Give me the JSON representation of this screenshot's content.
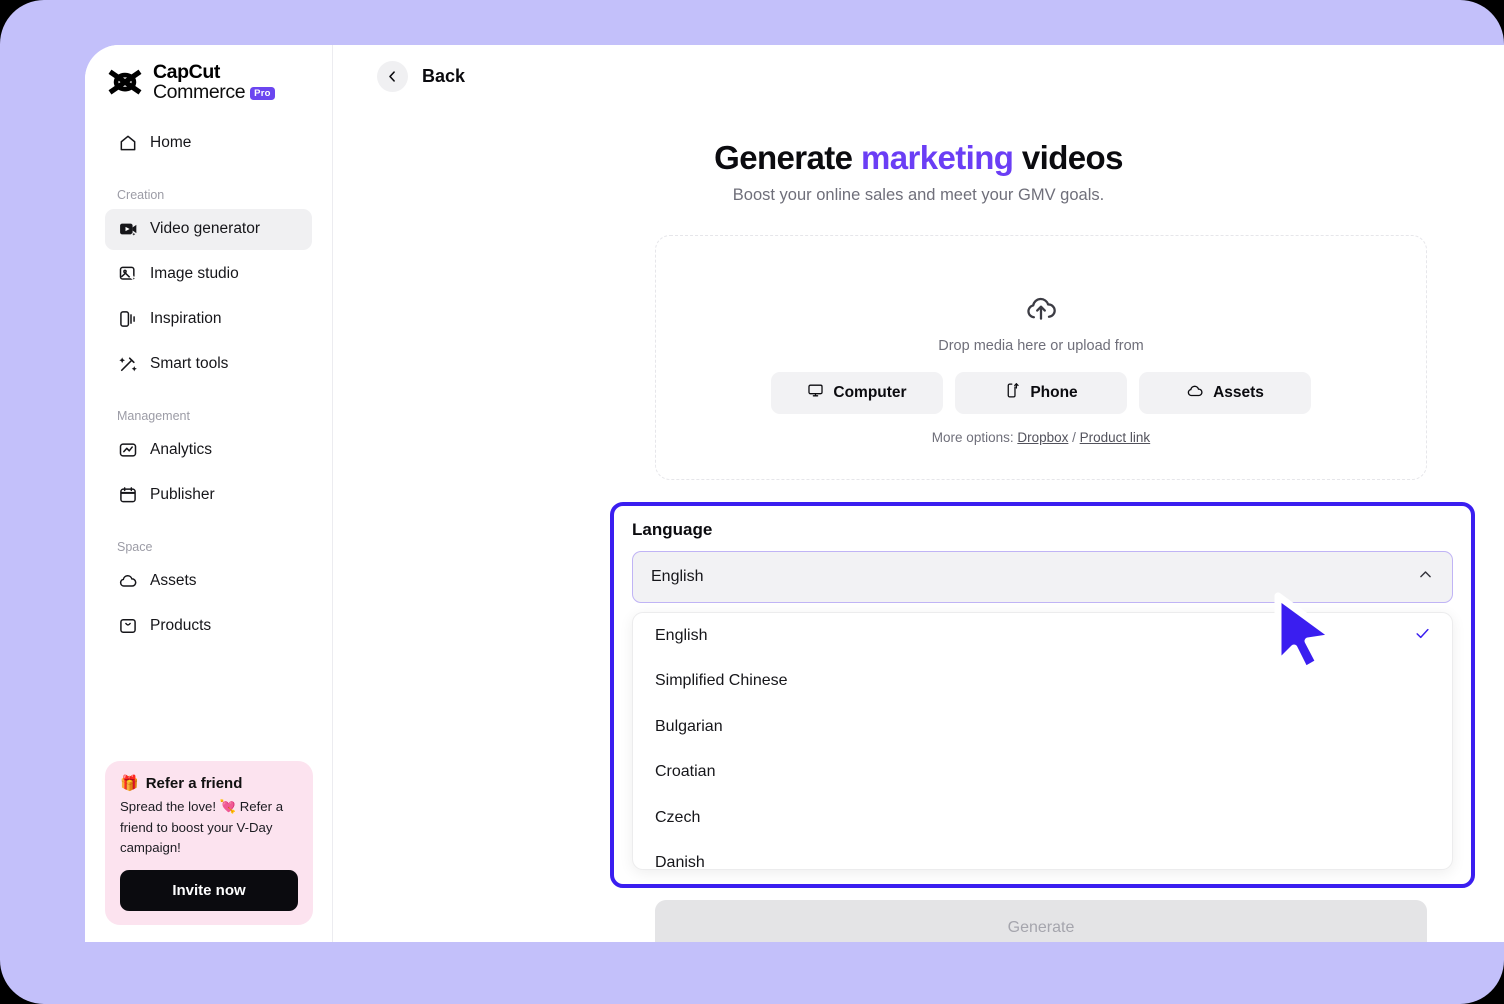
{
  "brand": {
    "name_line1": "CapCut",
    "name_line2": "Commerce",
    "badge": "Pro"
  },
  "sidebar": {
    "home": {
      "label": "Home",
      "icon": "home-icon"
    },
    "sections": [
      {
        "label": "Creation",
        "items": [
          {
            "label": "Video generator",
            "icon": "video-generator-icon",
            "active": true
          },
          {
            "label": "Image studio",
            "icon": "image-studio-icon",
            "active": false
          },
          {
            "label": "Inspiration",
            "icon": "inspiration-icon",
            "active": false
          },
          {
            "label": "Smart tools",
            "icon": "smart-tools-icon",
            "active": false
          }
        ]
      },
      {
        "label": "Management",
        "items": [
          {
            "label": "Analytics",
            "icon": "analytics-icon",
            "active": false
          },
          {
            "label": "Publisher",
            "icon": "publisher-icon",
            "active": false
          }
        ]
      },
      {
        "label": "Space",
        "items": [
          {
            "label": "Assets",
            "icon": "cloud-icon",
            "active": false
          },
          {
            "label": "Products",
            "icon": "products-icon",
            "active": false
          }
        ]
      }
    ],
    "refer_card": {
      "emoji": "🎁",
      "title": "Refer a friend",
      "body": "Spread the love! 💘 Refer a friend to boost your V-Day campaign!",
      "button": "Invite now"
    }
  },
  "topbar": {
    "back_label": "Back",
    "back_icon": "chevron-left-icon"
  },
  "hero": {
    "title_part1": "Generate ",
    "title_accent": "marketing",
    "title_part2": " videos",
    "subtitle": "Boost your online sales and meet your GMV goals.",
    "accent_color": "#6b3ef5"
  },
  "upload": {
    "icon": "cloud-upload-icon",
    "hint": "Drop media here or upload from",
    "buttons": [
      {
        "label": "Computer",
        "icon": "monitor-icon"
      },
      {
        "label": "Phone",
        "icon": "phone-upload-icon"
      },
      {
        "label": "Assets",
        "icon": "cloud-icon"
      }
    ],
    "more_options_prefix": "More options: ",
    "more_options_links": [
      "Dropbox",
      "Product link"
    ],
    "more_options_separator": " / "
  },
  "language": {
    "label": "Language",
    "selected": "English",
    "chevron_icon": "chevron-up-icon",
    "options": [
      {
        "label": "English",
        "selected": true
      },
      {
        "label": "Simplified Chinese",
        "selected": false
      },
      {
        "label": "Bulgarian",
        "selected": false
      },
      {
        "label": "Croatian",
        "selected": false
      },
      {
        "label": "Czech",
        "selected": false
      },
      {
        "label": "Danish",
        "selected": false
      }
    ],
    "highlight_color": "#3a1ef0"
  },
  "generate": {
    "label": "Generate",
    "disabled": true
  },
  "cursor": {
    "icon": "mouse-pointer",
    "color": "#3a1ef0"
  }
}
